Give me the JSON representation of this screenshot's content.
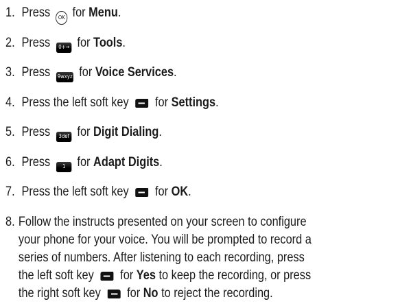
{
  "steps": [
    {
      "num": "1.",
      "pre": "Press",
      "key": "OK",
      "mid": "for",
      "bold": "Menu",
      "post": "."
    },
    {
      "num": "2.",
      "pre": "Press",
      "key": "0+→",
      "mid": "for",
      "bold": "Tools",
      "post": "."
    },
    {
      "num": "3.",
      "pre": "Press",
      "key": "9wxyz",
      "mid": "for",
      "bold": "Voice Services",
      "post": "."
    },
    {
      "num": "4.",
      "pre": "Press the left soft key",
      "mid": "for",
      "bold": "Settings",
      "post": "."
    },
    {
      "num": "5.",
      "pre": "Press",
      "key": "3def",
      "mid": "for",
      "bold": "Digit Dialing",
      "post": "."
    },
    {
      "num": "6.",
      "pre": "Press",
      "key": "1",
      "mid": "for",
      "bold": "Adapt Digits",
      "post": "."
    },
    {
      "num": "7.",
      "pre": "Press the left soft key",
      "mid": "for",
      "bold": "OK",
      "post": "."
    }
  ],
  "step8": {
    "num": "8.",
    "line1": "Follow the instructs presented on your screen to configure",
    "line2": "your phone for your voice. You will be prompted to record a",
    "line3": "series of numbers. After listening to each recording, press",
    "line4_pre": "the left soft key",
    "line4_mid": "for",
    "line4_bold": "Yes",
    "line4_post": "to keep the recording, or press",
    "line5_pre": "the right soft key",
    "line5_mid": "for",
    "line5_bold": "No",
    "line5_post": "to reject the recording."
  }
}
